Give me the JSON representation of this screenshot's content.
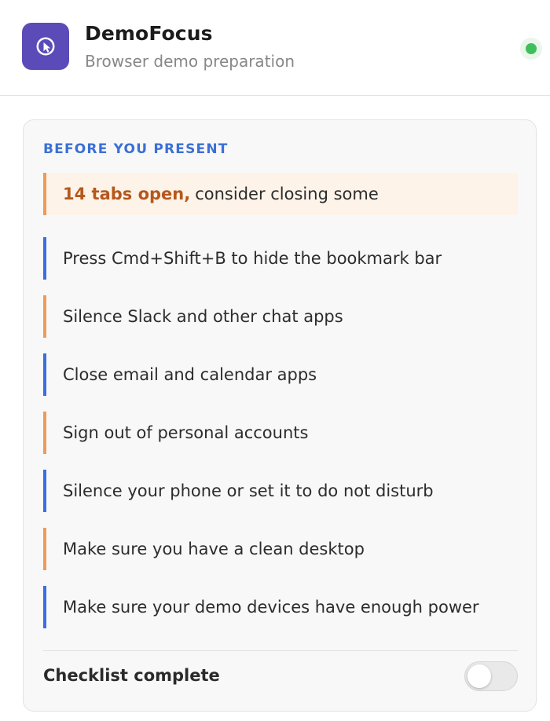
{
  "header": {
    "title": "DemoFocus",
    "subtitle": "Browser demo preparation",
    "icon": "cursor-click-icon",
    "accent_color": "#5a4bb8",
    "status_color": "#3fbf5a"
  },
  "checklist": {
    "section_title": "BEFORE YOU PRESENT",
    "warning": {
      "strong": "14 tabs open,",
      "text": "consider closing some"
    },
    "items": [
      {
        "label": "Press Cmd+Shift+B to hide the bookmark bar",
        "accent": "#3b6ee0"
      },
      {
        "label": "Silence Slack and other chat apps",
        "accent": "#ee9a5a"
      },
      {
        "label": "Close email and calendar apps",
        "accent": "#3b6ee0"
      },
      {
        "label": "Sign out of personal accounts",
        "accent": "#ee9a5a"
      },
      {
        "label": "Silence your phone or set it to do not disturb",
        "accent": "#3b6ee0"
      },
      {
        "label": "Make sure you have a clean desktop",
        "accent": "#ee9a5a"
      },
      {
        "label": "Make sure your demo devices have enough power",
        "accent": "#3b6ee0"
      }
    ],
    "complete_label": "Checklist complete",
    "complete_toggle_on": false
  }
}
